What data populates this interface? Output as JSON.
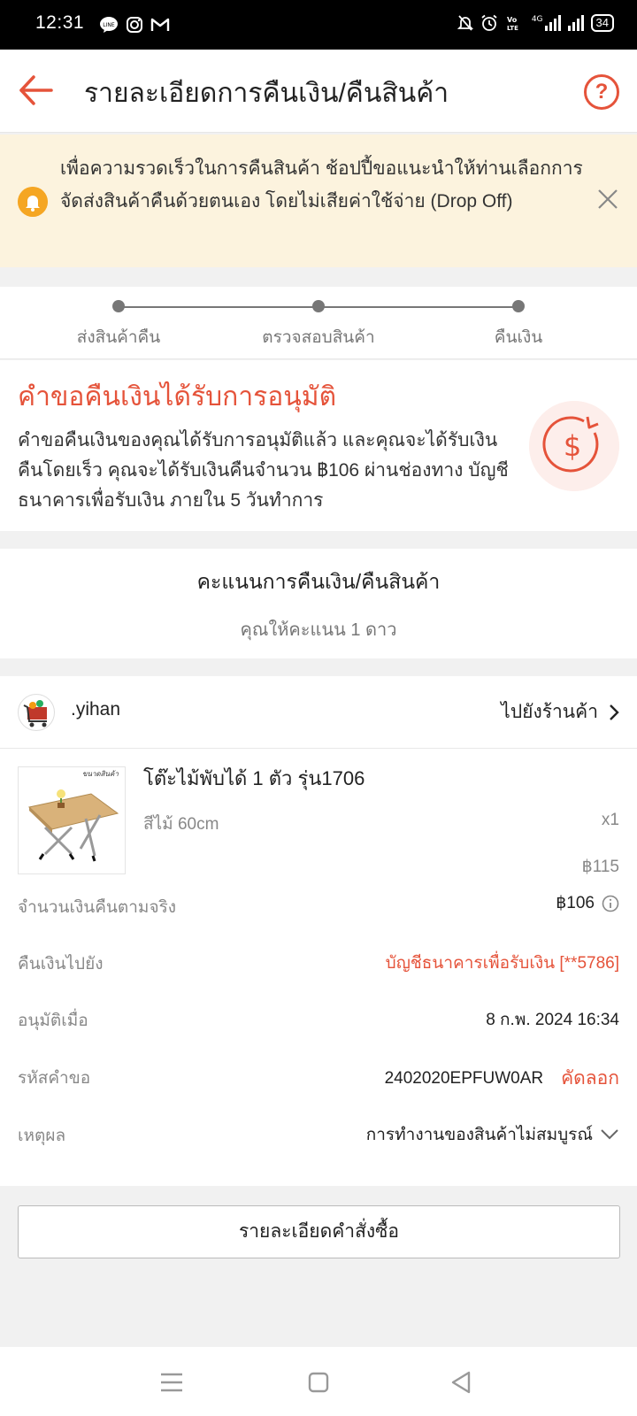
{
  "status_bar": {
    "time": "12:31",
    "battery": "34",
    "network": "4G",
    "app_icons": [
      "line-icon",
      "instagram-icon",
      "gmail-icon"
    ],
    "system_icons": [
      "mute-icon",
      "alarm-icon",
      "volte-icon",
      "signal-icon",
      "battery-icon"
    ]
  },
  "header": {
    "title": "รายละเอียดการคืนเงิน/คืนสินค้า",
    "help": "?"
  },
  "notice": {
    "text": "เพื่อความรวดเร็วในการคืนสินค้า ช้อปปี้ขอแนะนำให้ท่านเลือกการจัดส่งสินค้าคืนด้วยตนเอง โดยไม่เสียค่าใช้จ่าย (Drop Off)"
  },
  "progress": {
    "steps": [
      {
        "label": "ส่งสินค้าคืน"
      },
      {
        "label": "ตรวจสอบสินค้า"
      },
      {
        "label": "คืนเงิน"
      }
    ]
  },
  "status": {
    "title": "คำขอคืนเงินได้รับการอนุมัติ",
    "description": "คำขอคืนเงินของคุณได้รับการอนุมัติแล้ว และคุณจะได้รับเงินคืนโดยเร็ว คุณจะได้รับเงินคืนจำนวน ฿106 ผ่านช่องทาง บัญชีธนาคารเพื่อรับเงิน ภายใน 5 วันทำการ"
  },
  "rating": {
    "title": "คะแนนการคืนเงิน/คืนสินค้า",
    "subtitle": "คุณให้คะแนน 1 ดาว"
  },
  "shop": {
    "name": ".yihan",
    "link": "ไปยังร้านค้า"
  },
  "product": {
    "name": "โต๊ะไม้พับได้ 1 ตัว รุ่น1706",
    "variant": "สีไม้ 60cm",
    "qty": "x1",
    "price": "฿115",
    "image_label": "ขนาดสินค้า"
  },
  "details": {
    "actual_refund": {
      "label": "จำนวนเงินคืนตามจริง",
      "value": "฿106"
    },
    "refund_to": {
      "label": "คืนเงินไปยัง",
      "value": "บัญชีธนาคารเพื่อรับเงิน [**5786]"
    },
    "approved_at": {
      "label": "อนุมัติเมื่อ",
      "value": "8 ก.พ. 2024 16:34"
    },
    "request_id": {
      "label": "รหัสคำขอ",
      "value": "2402020EPFUW0AR",
      "copy": "คัดลอก"
    },
    "reason": {
      "label": "เหตุผล",
      "value": "การทำงานของสินค้าไม่สมบูรณ์"
    }
  },
  "order_button": "รายละเอียดคำสั่งซื้อ",
  "colors": {
    "accent": "#e5533a",
    "notice_bg": "#fcf3de",
    "notice_icon": "#f5a623"
  }
}
